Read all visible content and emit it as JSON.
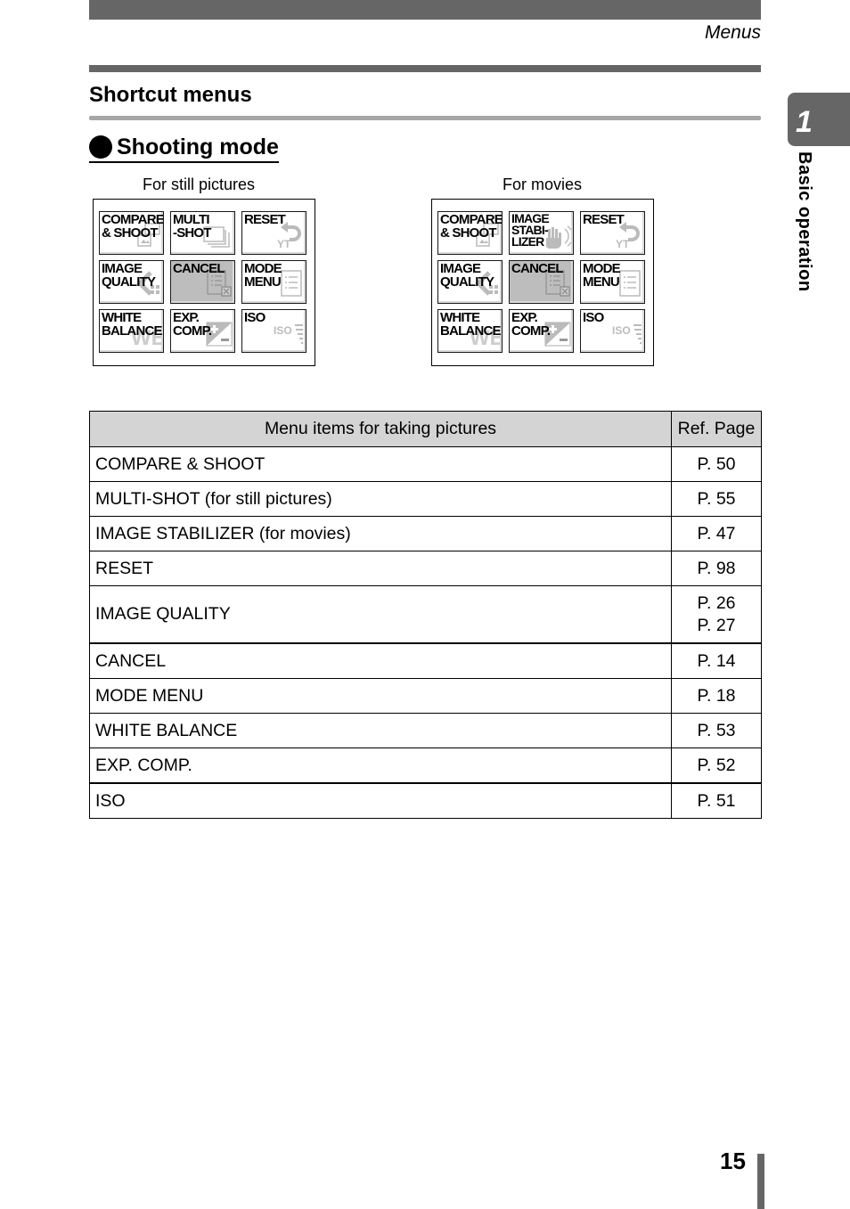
{
  "header": {
    "running_head": "Menus"
  },
  "side_tab": {
    "chapter_number": "1",
    "chapter_title": "Basic operation"
  },
  "section": {
    "title": "Shortcut menus",
    "subsection_title": "Shooting mode"
  },
  "panels": [
    {
      "caption": "For still pictures",
      "tiles": [
        {
          "label": "COMPARE\n& SHOOT",
          "icon": "compare-shoot-icon",
          "selected": false
        },
        {
          "label": "MULTI\n-SHOT",
          "icon": "multi-shot-icon",
          "selected": false
        },
        {
          "label": "RESET",
          "icon": "reset-icon",
          "selected": false
        },
        {
          "label": "IMAGE\nQUALITY",
          "icon": "image-quality-icon",
          "selected": false
        },
        {
          "label": "CANCEL",
          "icon": "cancel-icon",
          "selected": true
        },
        {
          "label": "MODE\nMENU",
          "icon": "mode-menu-icon",
          "selected": false
        },
        {
          "label": "WHITE\nBALANCE",
          "icon": "white-balance-icon",
          "selected": false
        },
        {
          "label": "EXP.\nCOMP.",
          "icon": "exp-comp-icon",
          "selected": false
        },
        {
          "label": "ISO",
          "icon": "iso-icon",
          "selected": false
        }
      ]
    },
    {
      "caption": "For movies",
      "tiles": [
        {
          "label": "COMPARE\n& SHOOT",
          "icon": "compare-shoot-icon",
          "selected": false
        },
        {
          "label": "IMAGE\nSTABI-\nLIZER",
          "icon": "image-stabilizer-icon",
          "selected": false
        },
        {
          "label": "RESET",
          "icon": "reset-icon",
          "selected": false
        },
        {
          "label": "IMAGE\nQUALITY",
          "icon": "image-quality-icon",
          "selected": false
        },
        {
          "label": "CANCEL",
          "icon": "cancel-icon",
          "selected": true
        },
        {
          "label": "MODE\nMENU",
          "icon": "mode-menu-icon",
          "selected": false
        },
        {
          "label": "WHITE\nBALANCE",
          "icon": "white-balance-icon",
          "selected": false
        },
        {
          "label": "EXP.\nCOMP.",
          "icon": "exp-comp-icon",
          "selected": false
        },
        {
          "label": "ISO",
          "icon": "iso-icon",
          "selected": false
        }
      ]
    }
  ],
  "table": {
    "headers": [
      "Menu items for taking pictures",
      "Ref. Page"
    ],
    "rows": [
      {
        "item": "COMPARE & SHOOT",
        "pages": [
          "P. 50"
        ]
      },
      {
        "item": "MULTI-SHOT (for still pictures)",
        "pages": [
          "P. 55"
        ]
      },
      {
        "item": "IMAGE STABILIZER (for movies)",
        "pages": [
          "P. 47"
        ]
      },
      {
        "item": "RESET",
        "pages": [
          "P. 98"
        ]
      },
      {
        "item": "IMAGE QUALITY",
        "pages": [
          "P. 26",
          "P. 27"
        ]
      },
      {
        "item": "CANCEL",
        "pages": [
          "P. 14"
        ]
      },
      {
        "item": "MODE MENU",
        "pages": [
          "P. 18"
        ]
      },
      {
        "item": "WHITE BALANCE",
        "pages": [
          "P. 53"
        ]
      },
      {
        "item": "EXP. COMP.",
        "pages": [
          "P. 52"
        ]
      },
      {
        "item": "ISO",
        "pages": [
          "P. 51"
        ]
      }
    ]
  },
  "footer": {
    "page_number": "15"
  },
  "colors": {
    "bar_dark": "#666666",
    "rule_light": "#a6a6a6",
    "table_header_bg": "#d4d4d4",
    "tile_selected_bg": "#bdbdbd"
  }
}
